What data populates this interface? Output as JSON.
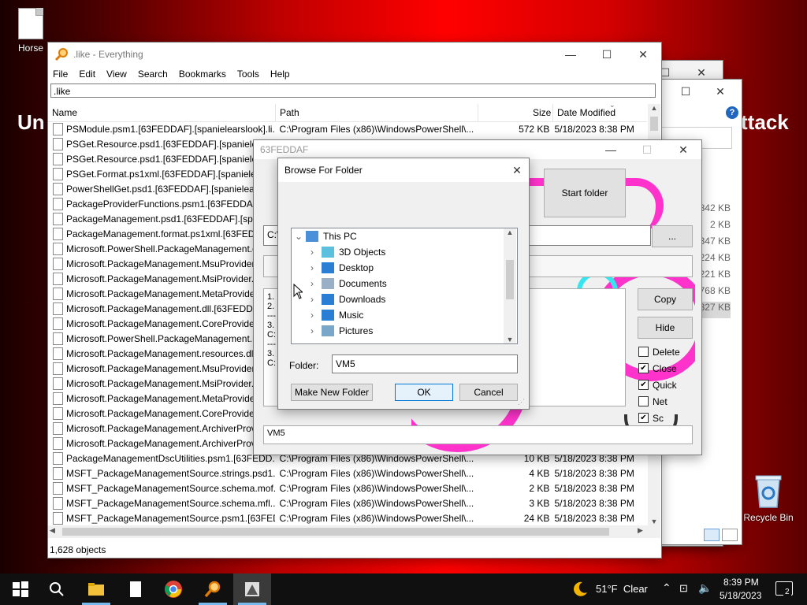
{
  "desktop": {
    "icon_horse": "Horse",
    "icon_recycle": "Recycle Bin",
    "text_left": "Un",
    "text_right": "ttack"
  },
  "back_window": {
    "sizes": [
      "842 KB",
      "2 KB",
      "347 KB",
      "224 KB",
      "221 KB",
      "768 KB",
      "827 KB"
    ]
  },
  "everything": {
    "title": ".like - Everything",
    "menu": [
      "File",
      "Edit",
      "View",
      "Search",
      "Bookmarks",
      "Tools",
      "Help"
    ],
    "search_value": ".like",
    "columns": {
      "name": "Name",
      "path": "Path",
      "size": "Size",
      "date": "Date Modified"
    },
    "rows": [
      {
        "name": "PSModule.psm1.[63FEDDAF].[spanielearslook].li...",
        "path": "C:\\Program Files (x86)\\WindowsPowerShell\\...",
        "size": "572 KB",
        "date": "5/18/2023 8:38 PM"
      },
      {
        "name": "PSGet.Resource.psd1.[63FEDDAF].[spanielears",
        "path": "",
        "size": "",
        "date": ""
      },
      {
        "name": "PSGet.Resource.psd1.[63FEDDAF].[spanielears",
        "path": "",
        "size": "",
        "date": ""
      },
      {
        "name": "PSGet.Format.ps1xml.[63FEDDAF].[spanielears",
        "path": "",
        "size": "",
        "date": ""
      },
      {
        "name": "PowerShellGet.psd1.[63FEDDAF].[spanielearsl",
        "path": "",
        "size": "",
        "date": ""
      },
      {
        "name": "PackageProviderFunctions.psm1.[63FEDDAF].",
        "path": "",
        "size": "",
        "date": ""
      },
      {
        "name": "PackageManagement.psd1.[63FEDDAF].[span",
        "path": "",
        "size": "",
        "date": ""
      },
      {
        "name": "PackageManagement.format.ps1xml.[63FEDDAF",
        "path": "",
        "size": "",
        "date": ""
      },
      {
        "name": "Microsoft.PowerShell.PackageManagement.d",
        "path": "",
        "size": "",
        "date": ""
      },
      {
        "name": "Microsoft.PackageManagement.MsuProvider",
        "path": "",
        "size": "",
        "date": ""
      },
      {
        "name": "Microsoft.PackageManagement.MsiProvider.",
        "path": "",
        "size": "",
        "date": ""
      },
      {
        "name": "Microsoft.PackageManagement.MetaProvide",
        "path": "",
        "size": "",
        "date": ""
      },
      {
        "name": "Microsoft.PackageManagement.dll.[63FEDDA",
        "path": "",
        "size": "",
        "date": ""
      },
      {
        "name": "Microsoft.PackageManagement.CoreProvider",
        "path": "",
        "size": "",
        "date": ""
      },
      {
        "name": "Microsoft.PowerShell.PackageManagement.r",
        "path": "",
        "size": "",
        "date": ""
      },
      {
        "name": "Microsoft.PackageManagement.resources.dll.",
        "path": "",
        "size": "",
        "date": ""
      },
      {
        "name": "Microsoft.PackageManagement.MsuProvider",
        "path": "",
        "size": "",
        "date": ""
      },
      {
        "name": "Microsoft.PackageManagement.MsiProvider.",
        "path": "",
        "size": "",
        "date": ""
      },
      {
        "name": "Microsoft.PackageManagement.MetaProvide",
        "path": "",
        "size": "",
        "date": ""
      },
      {
        "name": "Microsoft.PackageManagement.CoreProvider",
        "path": "",
        "size": "",
        "date": ""
      },
      {
        "name": "Microsoft.PackageManagement.ArchiverProv",
        "path": "",
        "size": "",
        "date": ""
      },
      {
        "name": "Microsoft.PackageManagement.ArchiverProv",
        "path": "",
        "size": "",
        "date": ""
      },
      {
        "name": "PackageManagementDscUtilities.psm1.[63FEDD...",
        "path": "C:\\Program Files (x86)\\WindowsPowerShell\\...",
        "size": "10 KB",
        "date": "5/18/2023 8:38 PM"
      },
      {
        "name": "MSFT_PackageManagementSource.strings.psd1....",
        "path": "C:\\Program Files (x86)\\WindowsPowerShell\\...",
        "size": "4 KB",
        "date": "5/18/2023 8:38 PM"
      },
      {
        "name": "MSFT_PackageManagementSource.schema.mof....",
        "path": "C:\\Program Files (x86)\\WindowsPowerShell\\...",
        "size": "2 KB",
        "date": "5/18/2023 8:38 PM"
      },
      {
        "name": "MSFT_PackageManagementSource.schema.mfl....",
        "path": "C:\\Program Files (x86)\\WindowsPowerShell\\...",
        "size": "3 KB",
        "date": "5/18/2023 8:38 PM"
      },
      {
        "name": "MSFT_PackageManagementSource.psm1.[63FED...",
        "path": "C:\\Program Files (x86)\\WindowsPowerShell\\...",
        "size": "24 KB",
        "date": "5/18/2023 8:38 PM"
      }
    ],
    "status": "1,628 objects"
  },
  "app_window": {
    "title": "63FEDDAF",
    "start_folder": "Start folder",
    "path_prefix": "C:\\",
    "browse_button": "...",
    "log_lines": [
      "1.",
      "2.",
      "---",
      "3.",
      "C:",
      "---",
      "3.",
      "C:"
    ],
    "copy": "Copy",
    "hide": "Hide",
    "options": [
      {
        "label": "Delete",
        "checked": false
      },
      {
        "label": "Close",
        "checked": true
      },
      {
        "label": "Quick",
        "checked": true
      },
      {
        "label": "Net",
        "checked": false
      },
      {
        "label": "Sc",
        "checked": true
      }
    ],
    "bottom_value": "VM5"
  },
  "browse_dialog": {
    "title": "Browse For Folder",
    "tree": [
      {
        "label": "This PC",
        "level": 0,
        "expanded": true,
        "icon": "pc-icon"
      },
      {
        "label": "3D Objects",
        "level": 1,
        "icon": "3d-objects-icon"
      },
      {
        "label": "Desktop",
        "level": 1,
        "icon": "desktop-icon"
      },
      {
        "label": "Documents",
        "level": 1,
        "icon": "documents-icon"
      },
      {
        "label": "Downloads",
        "level": 1,
        "icon": "downloads-icon"
      },
      {
        "label": "Music",
        "level": 1,
        "icon": "music-icon"
      },
      {
        "label": "Pictures",
        "level": 1,
        "icon": "pictures-icon"
      }
    ],
    "folder_label": "Folder:",
    "folder_value": "VM5",
    "make_new_folder": "Make New Folder",
    "ok": "OK",
    "cancel": "Cancel"
  },
  "taskbar": {
    "weather": "51°F  Clear",
    "time": "8:39 PM",
    "date": "5/18/2023",
    "notifications": "2"
  }
}
